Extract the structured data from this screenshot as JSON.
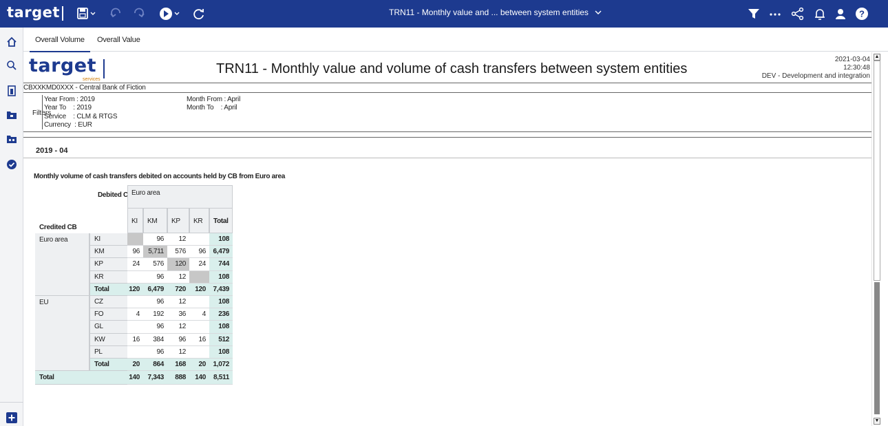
{
  "app": {
    "logo": "target",
    "report_short_title": "TRN11 - Monthly value and ... between system entities",
    "icons": [
      "save-icon",
      "undo-icon",
      "redo-icon",
      "run-icon",
      "refresh-icon",
      "filter-icon",
      "more-icon",
      "share-icon",
      "bell-icon",
      "user-icon",
      "help-icon"
    ]
  },
  "sidebar": {
    "icons": [
      "home-icon",
      "search-icon",
      "report-icon",
      "folder-icon",
      "shared-folder-icon",
      "check-icon",
      "add-icon"
    ]
  },
  "tabs": [
    {
      "label": "Overall Volume",
      "active": true
    },
    {
      "label": "Overall Value",
      "active": false
    }
  ],
  "report": {
    "logo": "target",
    "logo_sub": "services",
    "title": "TRN11 - Monthly value and volume of cash transfers between system entities",
    "date": "2021-03-04",
    "time": "12:30:48",
    "environment": "DEV - Development and integration",
    "central_bank": "CBXXKMD0XXX - Central Bank of Fiction",
    "filters_label": "Filters",
    "filters": {
      "year_from": "Year From : 2019",
      "year_to": "Year To    : 2019",
      "service": "Service    : CLM & RTGS",
      "currency": "Currency  : EUR",
      "month_from": "Month From : April",
      "month_to": "Month To    : April"
    },
    "period": "2019 - 04",
    "section_title": "Monthly volume of cash transfers debited on accounts held by CB from Euro area"
  },
  "table": {
    "debited_label": "Debited CB",
    "credited_label": "Credited CB",
    "area_header": "Euro area",
    "columns": [
      "KI",
      "KM",
      "KP",
      "KR",
      "Total"
    ],
    "groups": [
      {
        "name": "Euro area",
        "rows": [
          {
            "label": "KI",
            "values": [
              "",
              "96",
              "12",
              "",
              "108"
            ],
            "grey": [
              0
            ]
          },
          {
            "label": "KM",
            "values": [
              "96",
              "5,711",
              "576",
              "96",
              "6,479"
            ],
            "grey": [
              1
            ]
          },
          {
            "label": "KP",
            "values": [
              "24",
              "576",
              "120",
              "24",
              "744"
            ],
            "grey": [
              2
            ]
          },
          {
            "label": "KR",
            "values": [
              "",
              "96",
              "12",
              "",
              "108"
            ],
            "grey": [
              3
            ]
          },
          {
            "label": "Total",
            "values": [
              "120",
              "6,479",
              "720",
              "120",
              "7,439"
            ],
            "total": true
          }
        ]
      },
      {
        "name": "EU",
        "rows": [
          {
            "label": "CZ",
            "values": [
              "",
              "96",
              "12",
              "",
              "108"
            ]
          },
          {
            "label": "FO",
            "values": [
              "4",
              "192",
              "36",
              "4",
              "236"
            ]
          },
          {
            "label": "GL",
            "values": [
              "",
              "96",
              "12",
              "",
              "108"
            ]
          },
          {
            "label": "KW",
            "values": [
              "16",
              "384",
              "96",
              "16",
              "512"
            ]
          },
          {
            "label": "PL",
            "values": [
              "",
              "96",
              "12",
              "",
              "108"
            ]
          },
          {
            "label": "Total",
            "values": [
              "20",
              "864",
              "168",
              "20",
              "1,072"
            ],
            "total": true
          }
        ]
      }
    ],
    "grand_total": {
      "label": "Total",
      "values": [
        "140",
        "7,343",
        "888",
        "140",
        "8,511"
      ]
    }
  }
}
